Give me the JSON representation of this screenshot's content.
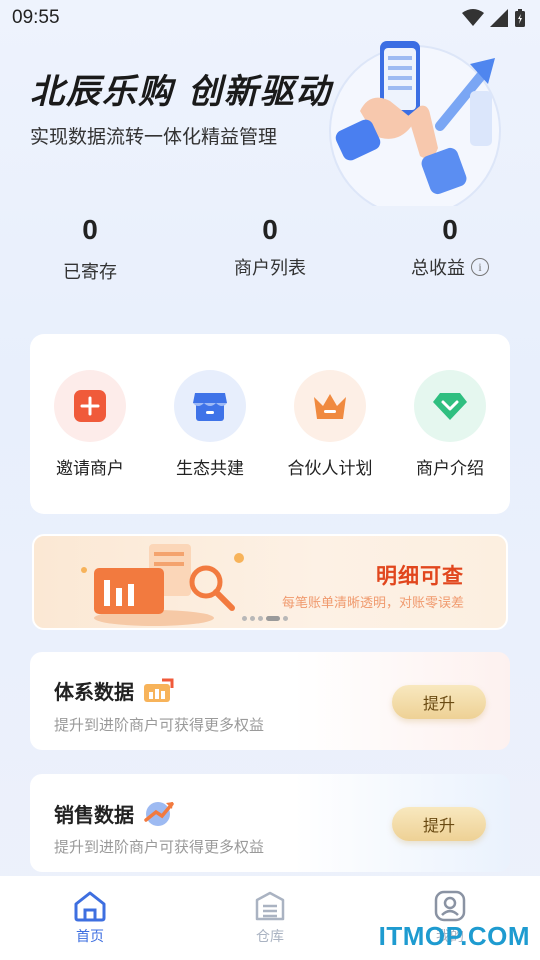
{
  "status": {
    "time": "09:55"
  },
  "hero": {
    "title": "北辰乐购 创新驱动",
    "subtitle": "实现数据流转一体化精益管理"
  },
  "stats": [
    {
      "value": "0",
      "label": "已寄存"
    },
    {
      "value": "0",
      "label": "商户列表"
    },
    {
      "value": "0",
      "label": "总收益"
    }
  ],
  "menu": [
    {
      "label": "邀请商户",
      "icon": "plus-icon",
      "bg": "#fdecea",
      "color": "#f05a3a"
    },
    {
      "label": "生态共建",
      "icon": "shop-icon",
      "bg": "#e7eefc",
      "color": "#3f73e8"
    },
    {
      "label": "合伙人计划",
      "icon": "crown-icon",
      "bg": "#fdefe6",
      "color": "#f08a40"
    },
    {
      "label": "商户介绍",
      "icon": "diamond-icon",
      "bg": "#e5f7ef",
      "color": "#2fbf80"
    }
  ],
  "banner": {
    "title": "明细可查",
    "subtitle": "每笔账单清晰透明，对账零误差"
  },
  "promos": [
    {
      "title": "体系数据",
      "subtitle": "提升到进阶商户可获得更多权益",
      "button": "提升"
    },
    {
      "title": "销售数据",
      "subtitle": "提升到进阶商户可获得更多权益",
      "button": "提升"
    }
  ],
  "tabs": [
    {
      "label": "首页",
      "active": true
    },
    {
      "label": "仓库",
      "active": false
    },
    {
      "label": "我的",
      "active": false
    }
  ],
  "watermark": "ITMOP.COM",
  "colors": {
    "accent": "#3e6fe0",
    "banner_title": "#e1461d"
  }
}
